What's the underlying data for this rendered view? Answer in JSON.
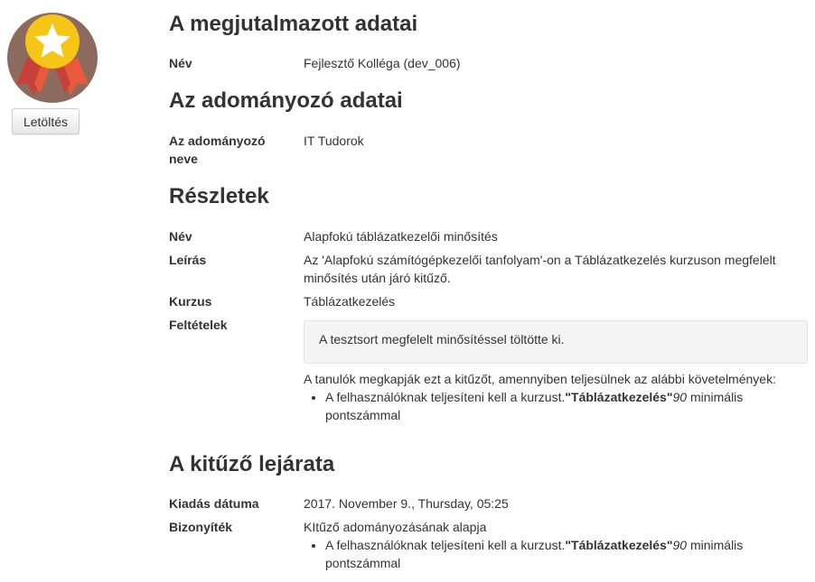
{
  "badge": {
    "icon": "star-medal-icon",
    "colors": {
      "circle": "#8c6b5e",
      "medal": "#f5c518",
      "ribbon": "#e95a3a"
    }
  },
  "download_button": "Letöltés",
  "recipient": {
    "heading": "A megjutalmazott adatai",
    "name_label": "Név",
    "name_value": "Fejlesztő Kolléga (dev_006)"
  },
  "issuer": {
    "heading": "Az adományozó adatai",
    "name_label": "Az adományozó neve",
    "name_value": "IT Tudorok"
  },
  "details": {
    "heading": "Részletek",
    "name_label": "Név",
    "name_value": "Alapfokú táblázatkezelői minősítés",
    "description_label": "Leírás",
    "description_value": "Az 'Alapfokú számítógépkezelői tanfolyam'-on a Táblázatkezelés kurzuson megfelelt minősítés után járó kitűző.",
    "course_label": "Kurzus",
    "course_value": "Táblázatkezelés",
    "criteria_label": "Feltételek",
    "criteria_box": "A tesztsort megfelelt minősítéssel töltötte ki.",
    "criteria_intro": "A tanulók megkapják ezt a kitűzőt, amennyiben teljesülnek az alábbi követelmények:",
    "criteria_item": {
      "prefix": "A felhasználóknak teljesíteni kell a kurzust.",
      "course": "\"Táblázatkezelés\"",
      "score": "90",
      "suffix": " minimális pontszámmal"
    }
  },
  "expiry": {
    "heading": "A kitűző lejárata",
    "issued_label": "Kiadás dátuma",
    "issued_value": "2017. November 9., Thursday, 05:25",
    "evidence_label": "Bizonyíték",
    "evidence_value": "KItűző adományozásának alapja",
    "evidence_item": {
      "prefix": "A felhasználóknak teljesíteni kell a kurzust.",
      "course": "\"Táblázatkezelés\"",
      "score": "90",
      "suffix": " minimális pontszámmal"
    }
  }
}
